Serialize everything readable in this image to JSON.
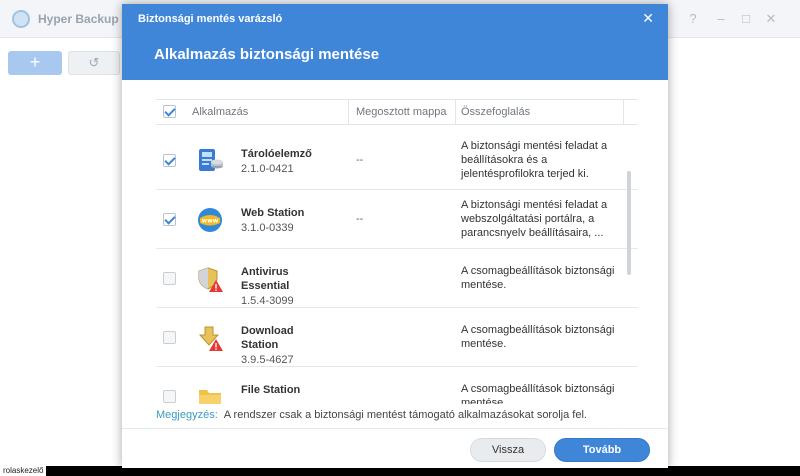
{
  "app": {
    "title": "Hyper Backup",
    "window_controls": [
      "?",
      "–",
      "□",
      "✕"
    ],
    "toolbar": {
      "add_label": "+",
      "history_label": "↺"
    }
  },
  "taskbar": {
    "label": "rolaskezelő"
  },
  "wizard": {
    "window_title": "Biztonsági mentés varázsló",
    "close_label": "✕",
    "heading": "Alkalmazás biztonsági mentése",
    "table": {
      "columns": [
        "Alkalmazás",
        "Megosztott mappa",
        "Összefoglalás"
      ],
      "rows": [
        {
          "name": "Tárolóelemző",
          "version": "2.1.0-0421",
          "shared": "--",
          "summary": "A biztonsági mentési feladat a beállításokra és a jelentésprofilokra terjed ki.",
          "checked": true,
          "icon": "storage-analyzer-icon"
        },
        {
          "name": "Web Station",
          "version": "3.1.0-0339",
          "shared": "--",
          "summary": "A biztonsági mentési feladat a webszolgáltatási portálra, a parancsnyelv beállításaira, ...",
          "checked": true,
          "icon": "web-station-icon"
        },
        {
          "name": "Antivirus Essential",
          "version": "1.5.4-3099",
          "shared": "",
          "summary": "A csomagbeállítások biztonsági mentése.",
          "checked": false,
          "icon": "antivirus-icon"
        },
        {
          "name": "Download Station",
          "version": "3.9.5-4627",
          "shared": "",
          "summary": "A csomagbeállítások biztonsági mentése.",
          "checked": false,
          "icon": "download-station-icon"
        },
        {
          "name": "File Station",
          "version": "",
          "shared": "",
          "summary": "A csomagbeállítások biztonsági mentése.",
          "checked": false,
          "icon": "file-station-icon"
        }
      ]
    },
    "note": {
      "label": "Megjegyzés:",
      "text": "A rendszer csak a biztonsági mentést támogató alkalmazásokat sorolja fel."
    },
    "buttons": {
      "back": "Vissza",
      "next": "Tovább"
    },
    "accent_color": "#3f86d8"
  }
}
